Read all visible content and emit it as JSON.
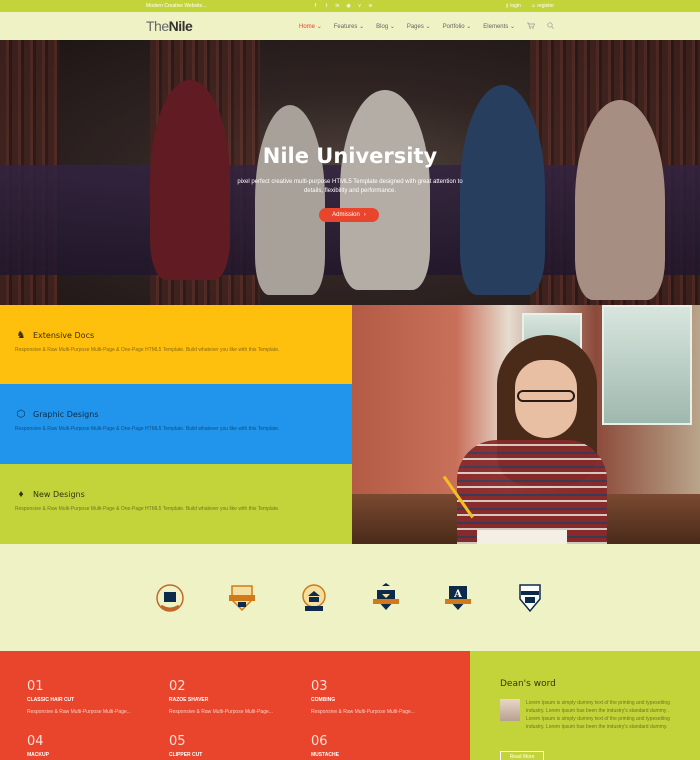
{
  "topbar": {
    "tagline": "Modern Creative Website...",
    "social": [
      {
        "icon": "facebook-icon",
        "glyph": "f"
      },
      {
        "icon": "twitter-icon",
        "glyph": "t"
      },
      {
        "icon": "linkedin-icon",
        "glyph": "in"
      },
      {
        "icon": "dribbble-icon",
        "glyph": "◉"
      },
      {
        "icon": "vimeo-icon",
        "glyph": "v"
      },
      {
        "icon": "rss-icon",
        "glyph": "≋"
      }
    ],
    "login": "login",
    "register": "register"
  },
  "nav": {
    "logo_light": "The",
    "logo_bold": "Nile",
    "items": [
      {
        "label": "Home",
        "active": true
      },
      {
        "label": "Features"
      },
      {
        "label": "Blog"
      },
      {
        "label": "Pages"
      },
      {
        "label": "Portfolio"
      },
      {
        "label": "Elements"
      }
    ],
    "cart_icon": "cart-icon",
    "search_icon": "search-icon"
  },
  "hero": {
    "title": "Nile University",
    "subtitle": "pixel perfect creative multi-purpose HTML5 Template designed with great attention to details, flexibility and performance.",
    "button": "Admission",
    "button_arrow": "›"
  },
  "features": [
    {
      "title": "Extensive Docs",
      "icon": "chess-knight-icon",
      "glyph": "♞",
      "desc": "Responsive & Raw Multi-Purpose Multi-Page & One-Page HTML5 Template. Build whatever you like with this Template."
    },
    {
      "title": "Graphic Designs",
      "icon": "codepen-icon",
      "glyph": "⬡",
      "desc": "Responsive & Raw Multi-Purpose Multi-Page & One-Page HTML5 Template. Build whatever you like with this Template."
    },
    {
      "title": "New Designs",
      "icon": "balloon-icon",
      "glyph": "♦",
      "desc": "Responsive & Raw Multi-Purpose Multi-Page & One-Page HTML5 Template. Build whatever you like with this Template."
    }
  ],
  "logos": [
    {
      "name": "college-campus-logo",
      "text": "COLLEGE CAMPUS"
    },
    {
      "name": "university-logo",
      "text": "UNIVERSITY"
    },
    {
      "name": "college-logo",
      "text": "COLLEGE"
    },
    {
      "name": "crown-crest-logo",
      "text": ""
    },
    {
      "name": "a-crest-logo",
      "text": "A"
    },
    {
      "name": "university-shield-logo",
      "text": "UNIVERSITY"
    }
  ],
  "services": [
    {
      "num": "01",
      "title": "CLASSIC HAIR CUT",
      "text": "Responsive & Raw Multi-Purpose Multi-Page..."
    },
    {
      "num": "02",
      "title": "RAZOE SHAVER",
      "text": "Responsive & Raw Multi-Purpose Multi-Page..."
    },
    {
      "num": "03",
      "title": "COMBING",
      "text": "Responsive & Raw Multi-Purpose Multi-Page..."
    },
    {
      "num": "04",
      "title": "MACKUP",
      "text": ""
    },
    {
      "num": "05",
      "title": "CLIPPER CUT",
      "text": ""
    },
    {
      "num": "06",
      "title": "MUSTACHE",
      "text": ""
    }
  ],
  "dean": {
    "title": "Dean's word",
    "quote": "Lorem Ipsum is simply dummy text of the printing and typesetting industry. Lorem Ipsum has been the industry's standard dummy . Lorem Ipsum is simply dummy text of the printing and typesetting industry. Lorem Ipsum has been the industry's standard dummy.",
    "button": "Read More"
  },
  "colors": {
    "accent": "#e8452c",
    "lime": "#c3d43b",
    "yellow": "#ffbf0c",
    "blue": "#2194ec",
    "background": "#eef2c4"
  }
}
